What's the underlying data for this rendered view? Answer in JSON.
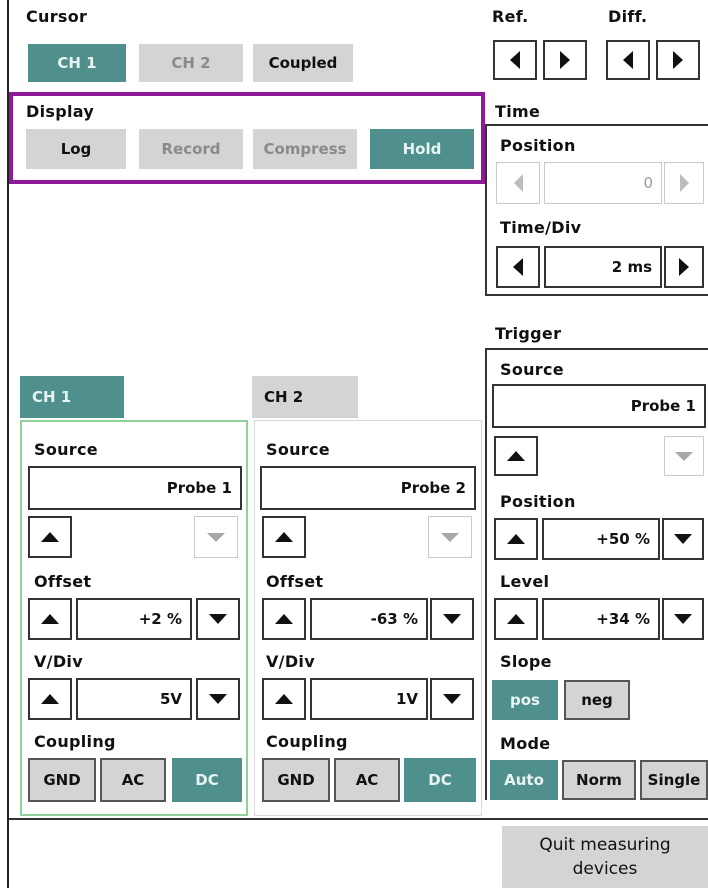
{
  "cursor": {
    "label": "Cursor",
    "ch1": "CH 1",
    "ch2": "CH 2",
    "coupled": "Coupled"
  },
  "ref": {
    "label": "Ref."
  },
  "diff": {
    "label": "Diff."
  },
  "display": {
    "label": "Display",
    "log": "Log",
    "record": "Record",
    "compress": "Compress",
    "hold": "Hold"
  },
  "time": {
    "label": "Time",
    "position_label": "Position",
    "position_value": "0",
    "timediv_label": "Time/Div",
    "timediv_value": "2 ms"
  },
  "trigger": {
    "label": "Trigger",
    "source_label": "Source",
    "source_value": "Probe 1",
    "position_label": "Position",
    "position_value": "+50 %",
    "level_label": "Level",
    "level_value": "+34 %",
    "slope_label": "Slope",
    "slope_pos": "pos",
    "slope_neg": "neg",
    "mode_label": "Mode",
    "mode_auto": "Auto",
    "mode_norm": "Norm",
    "mode_single": "Single"
  },
  "ch1": {
    "tab": "CH 1",
    "source_label": "Source",
    "source_value": "Probe 1",
    "offset_label": "Offset",
    "offset_value": "+2 %",
    "vdiv_label": "V/Div",
    "vdiv_value": "5V",
    "coupling_label": "Coupling",
    "gnd": "GND",
    "ac": "AC",
    "dc": "DC"
  },
  "ch2": {
    "tab": "CH 2",
    "source_label": "Source",
    "source_value": "Probe 2",
    "offset_label": "Offset",
    "offset_value": "-63 %",
    "vdiv_label": "V/Div",
    "vdiv_value": "1V",
    "coupling_label": "Coupling",
    "gnd": "GND",
    "ac": "AC",
    "dc": "DC"
  },
  "footer": {
    "quit_line1": "Quit measuring",
    "quit_line2": "devices"
  },
  "colors": {
    "accent": "#4f8f8c",
    "button_grey": "#d4d4d4",
    "highlight": "#8e1a9a",
    "ch1_outline": "#8fd19a"
  }
}
